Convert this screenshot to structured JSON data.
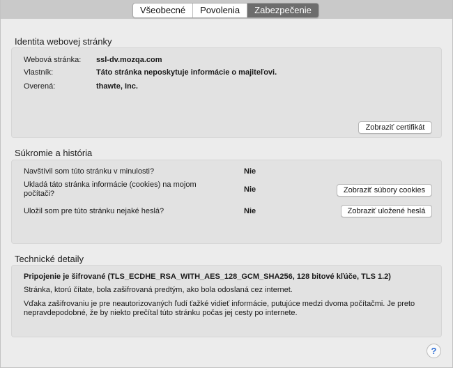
{
  "tabs": [
    {
      "label": "Všeobecné",
      "active": false
    },
    {
      "label": "Povolenia",
      "active": false
    },
    {
      "label": "Zabezpečenie",
      "active": true
    }
  ],
  "identity": {
    "title": "Identita webovej stránky",
    "rows": [
      {
        "label": "Webová stránka:",
        "value": "ssl-dv.mozqa.com"
      },
      {
        "label": "Vlastník:",
        "value": "Táto stránka neposkytuje informácie o majiteľovi."
      },
      {
        "label": "Overená:",
        "value": "thawte, Inc."
      }
    ],
    "view_cert_label": "Zobraziť certifikát"
  },
  "privacy": {
    "title": "Súkromie a história",
    "rows": [
      {
        "question": "Navštívil som túto stránku v minulosti?",
        "answer": "Nie"
      },
      {
        "question": "Ukladá táto stránka informácie (cookies) na mojom počítači?",
        "answer": "Nie",
        "button": "Zobraziť súbory cookies"
      },
      {
        "question": "Uložil som pre túto stránku nejaké heslá?",
        "answer": "Nie",
        "button": "Zobraziť uložené heslá"
      }
    ]
  },
  "technical": {
    "title": "Technické detaily",
    "headline": "Pripojenie je šifrované (TLS_ECDHE_RSA_WITH_AES_128_GCM_SHA256, 128 bitové kľúče, TLS 1.2)",
    "line1": "Stránka, ktorú čítate, bola zašifrovaná predtým, ako bola odoslaná cez internet.",
    "line2": "Vďaka zašifrovaniu je pre neautorizovaných ľudí ťažké vidieť informácie, putujúce medzi dvoma počítačmi. Je preto nepravdepodobné, že by niekto prečítal túto stránku počas jej cesty po internete."
  },
  "help_label": "?"
}
